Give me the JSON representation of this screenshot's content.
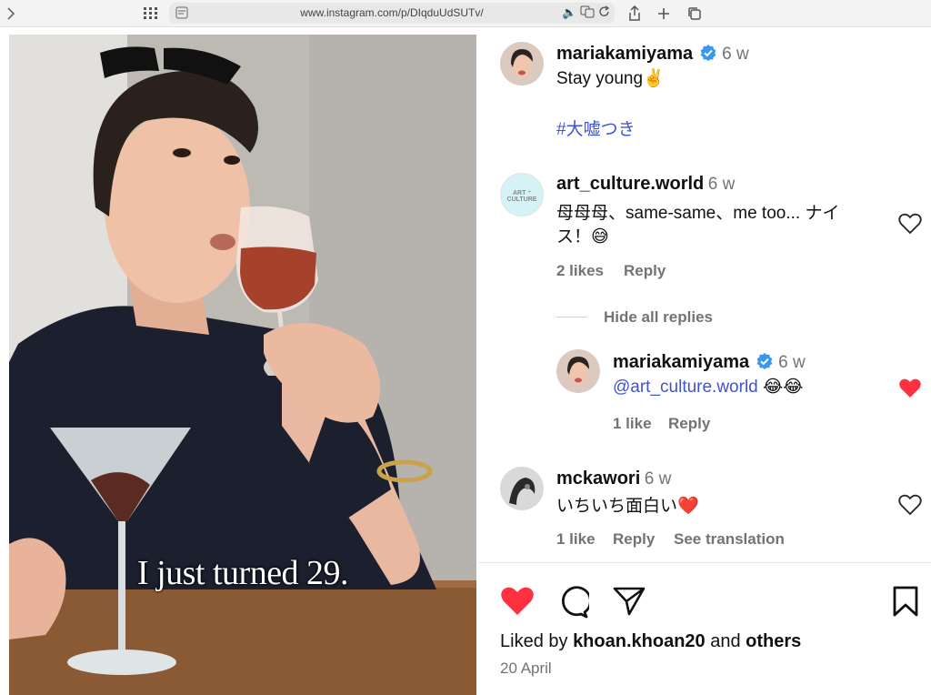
{
  "browser": {
    "url": "www.instagram.com/p/DIqduUdSUTv/"
  },
  "media": {
    "caption_overlay": "I just turned 29."
  },
  "post": {
    "author": "mariakamiyama",
    "time": "6 w",
    "caption": "Stay young✌️",
    "hashtag": "#大嘘つき"
  },
  "comments": [
    {
      "username": "art_culture.world",
      "time": "6 w",
      "text_line1": "母母母、same-same、me too... ナイ",
      "text_line2": "ス！😅",
      "likes": "2 likes",
      "reply": "Reply",
      "avatar_text": "ART ⁺ CULTURE"
    },
    {
      "hide_replies": "Hide all replies"
    },
    {
      "username": "mariakamiyama",
      "time": "6 w",
      "text": "@art_culture.world",
      "emoji": "😂😂",
      "likes": "1 like",
      "reply": "Reply"
    },
    {
      "username": "mckawori",
      "time": "6 w",
      "text": "いちいち面白い❤️",
      "likes": "1 like",
      "reply": "Reply",
      "translation": "See translation"
    }
  ],
  "footer": {
    "liked_by_prefix": "Liked by",
    "liked_by_user": "khoan.khoan20",
    "liked_by_and": "and",
    "liked_by_others": "others",
    "date": "20 April"
  },
  "colors": {
    "like_red": "#ff3040",
    "link_blue": "#4052d6",
    "verified_blue": "#3897f0",
    "muted": "#737373"
  }
}
